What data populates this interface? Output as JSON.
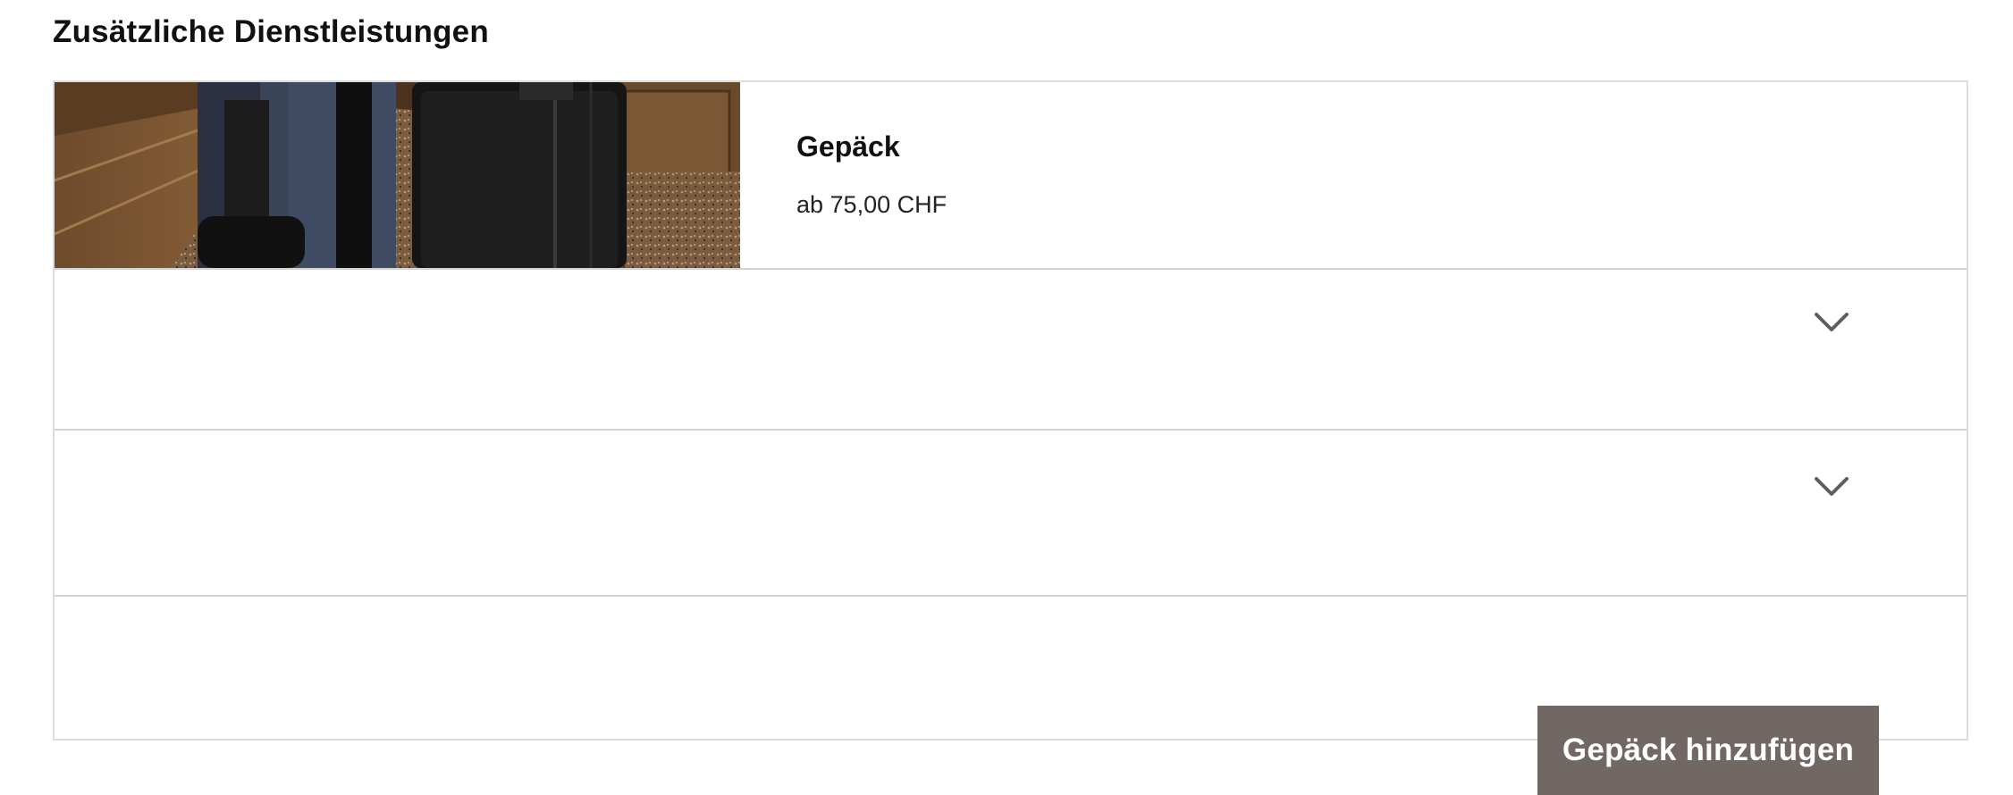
{
  "section": {
    "title": "Zusätzliche Dienstleistungen"
  },
  "service_card": {
    "title": "Gepäck",
    "price": "ab 75,00 CHF",
    "image_icon": "luggage-photo",
    "add_button_label": "Gepäck hinzufügen",
    "button_color": "#726863"
  },
  "accordions": [
    {
      "icon": "chevron-down-icon",
      "expanded": false
    },
    {
      "icon": "chevron-down-icon",
      "expanded": false
    }
  ]
}
